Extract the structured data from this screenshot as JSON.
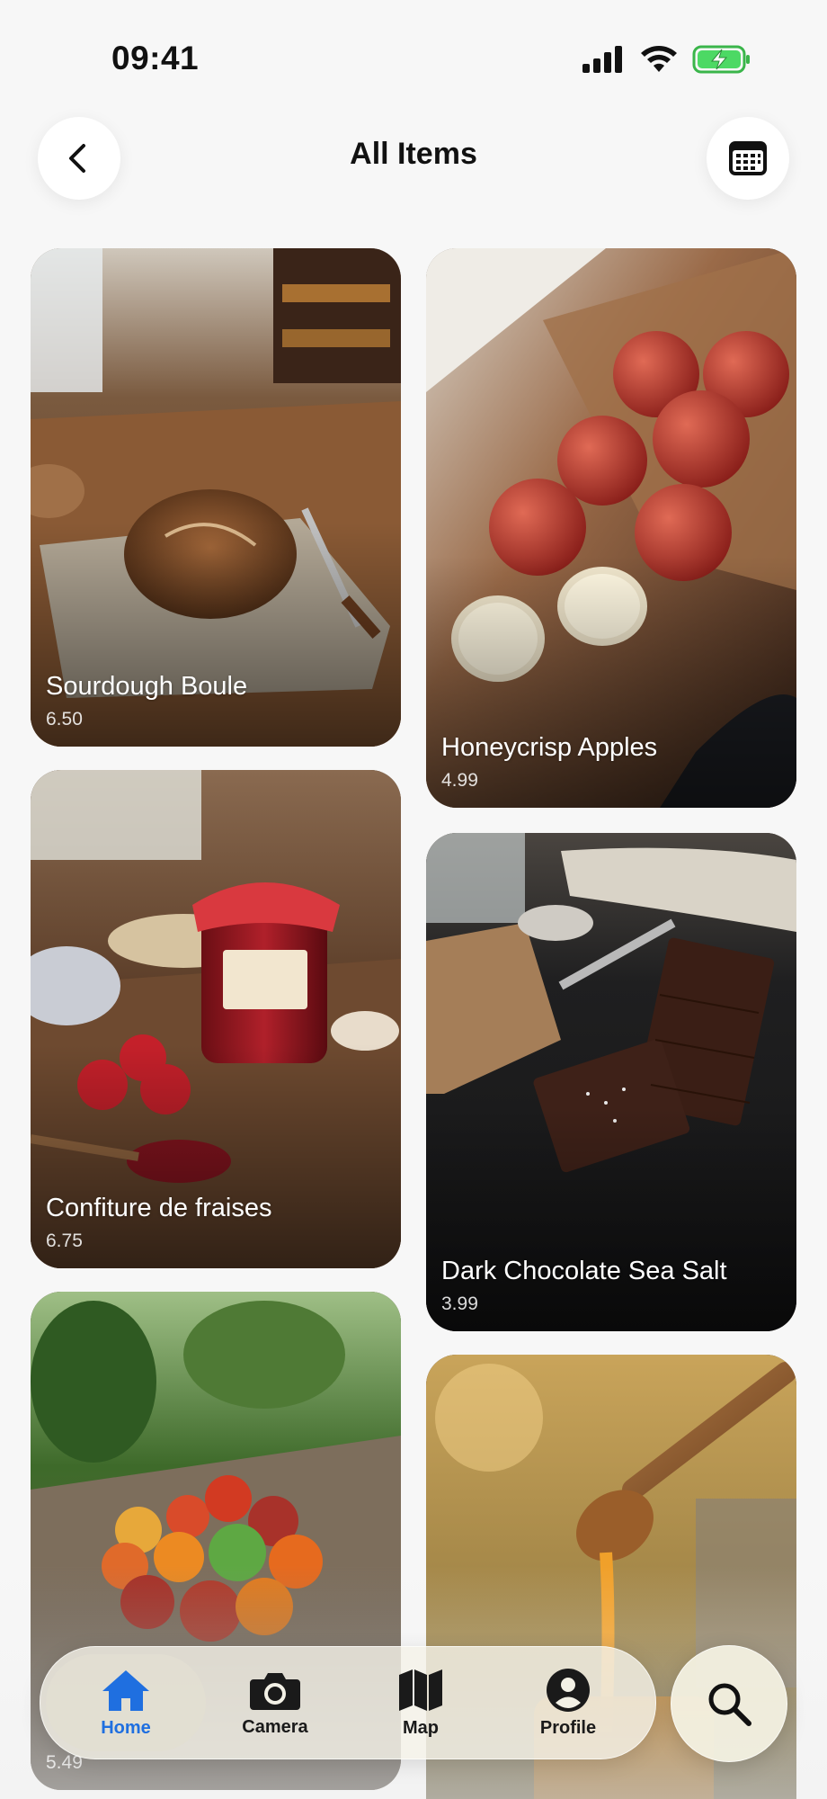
{
  "status_bar": {
    "time": "09:41"
  },
  "header": {
    "title": "All Items",
    "back_icon": "chevron-left-icon",
    "calendar_icon": "calendar-icon"
  },
  "items": [
    {
      "name": "Sourdough Boule",
      "price": "6.50"
    },
    {
      "name": "Honeycrisp Apples",
      "price": "4.99"
    },
    {
      "name": "Confiture de fraises",
      "price": "6.75"
    },
    {
      "name": "Dark Chocolate Sea Salt",
      "price": "3.99"
    },
    {
      "name": "",
      "price": "5.49"
    },
    {
      "name": "",
      "price": ""
    }
  ],
  "tab_bar": {
    "tabs": [
      {
        "label": "Home",
        "icon": "home-icon",
        "active": true
      },
      {
        "label": "Camera",
        "icon": "camera-icon",
        "active": false
      },
      {
        "label": "Map",
        "icon": "map-icon",
        "active": false
      },
      {
        "label": "Profile",
        "icon": "profile-icon",
        "active": false
      }
    ],
    "search_icon": "search-icon"
  },
  "colors": {
    "accent": "#1f6fe0",
    "background": "#f7f7f7"
  }
}
